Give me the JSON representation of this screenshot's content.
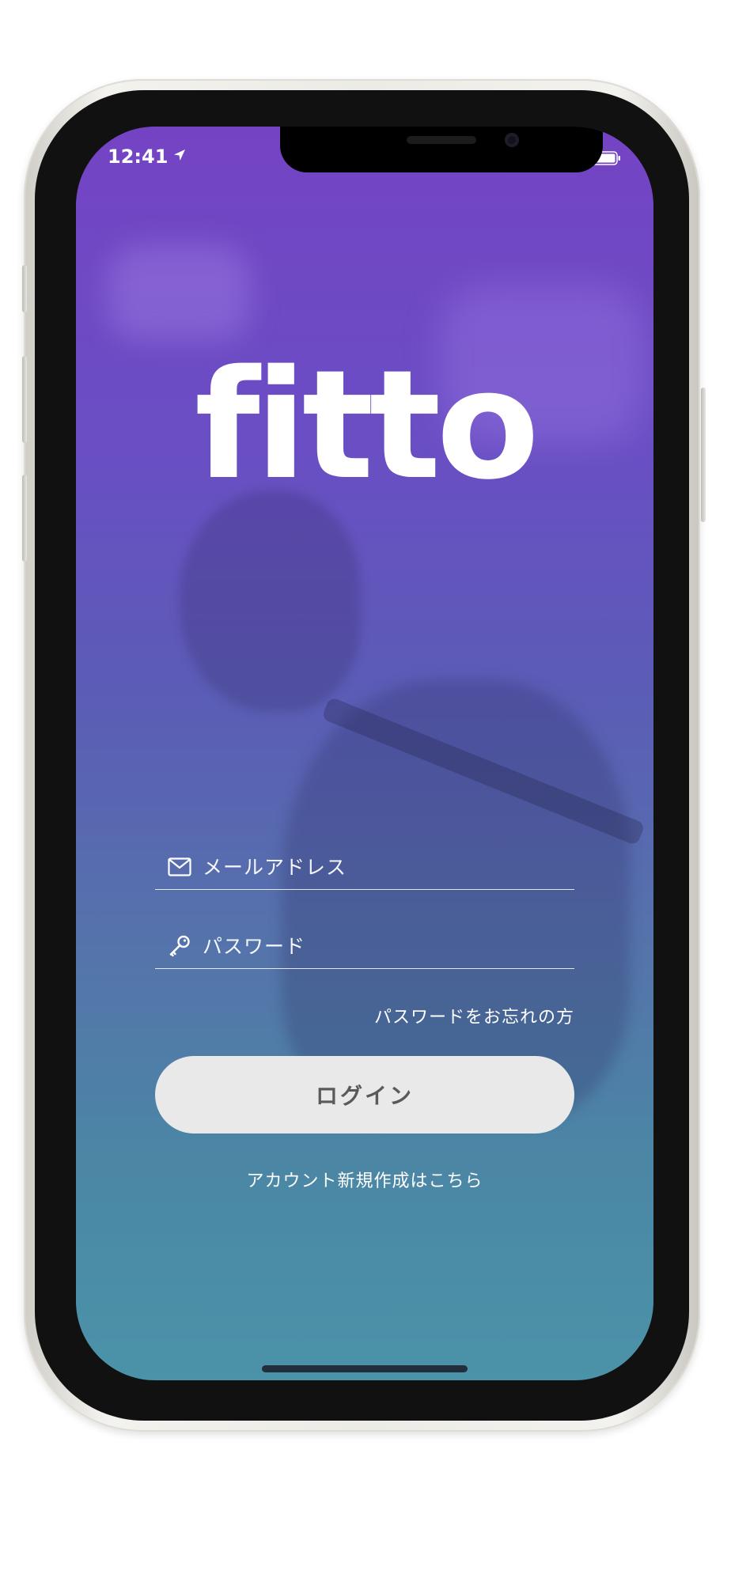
{
  "status_bar": {
    "time": "12:41",
    "location_icon": "location-arrow-icon",
    "signal_icon": "cellular-signal-icon",
    "wifi_icon": "wifi-icon",
    "battery_icon": "battery-icon"
  },
  "app": {
    "logo_text": "fitto"
  },
  "form": {
    "email_placeholder": "メールアドレス",
    "email_icon": "mail-icon",
    "password_placeholder": "パスワード",
    "password_icon": "key-icon",
    "forgot_password_label": "パスワードをお忘れの方",
    "login_label": "ログイン",
    "signup_label": "アカウント新規作成はこちら"
  },
  "colors": {
    "gradient_top": "#7443c4",
    "gradient_bottom": "#4b93a8",
    "button_bg": "#e9e9ea",
    "button_text": "#5a5a5a",
    "text": "#ffffff"
  }
}
